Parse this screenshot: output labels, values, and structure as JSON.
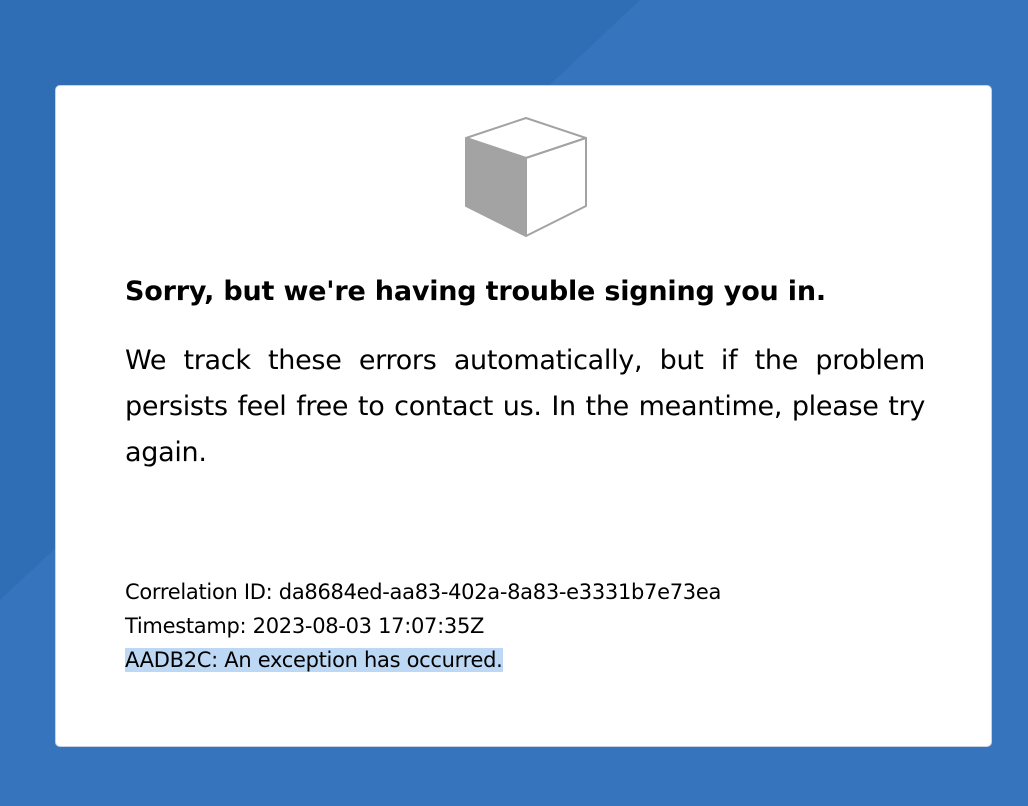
{
  "colors": {
    "page_background": "#2f6db5",
    "card_background": "#ffffff",
    "selection_highlight": "#bcd8f5",
    "cube_fill": "#a3a3a3",
    "cube_stroke": "#a3a3a3"
  },
  "card": {
    "icon": "cube-icon",
    "title": "Sorry, but we're having trouble signing you in.",
    "message": "We track these errors automatically, but if the problem persists feel free to contact us. In the meantime, please try again."
  },
  "details": {
    "correlation_id": "Correlation ID: da8684ed-aa83-402a-8a83-e3331b7e73ea",
    "timestamp": "Timestamp: 2023-08-03 17:07:35Z",
    "error": "AADB2C: An exception has occurred."
  }
}
